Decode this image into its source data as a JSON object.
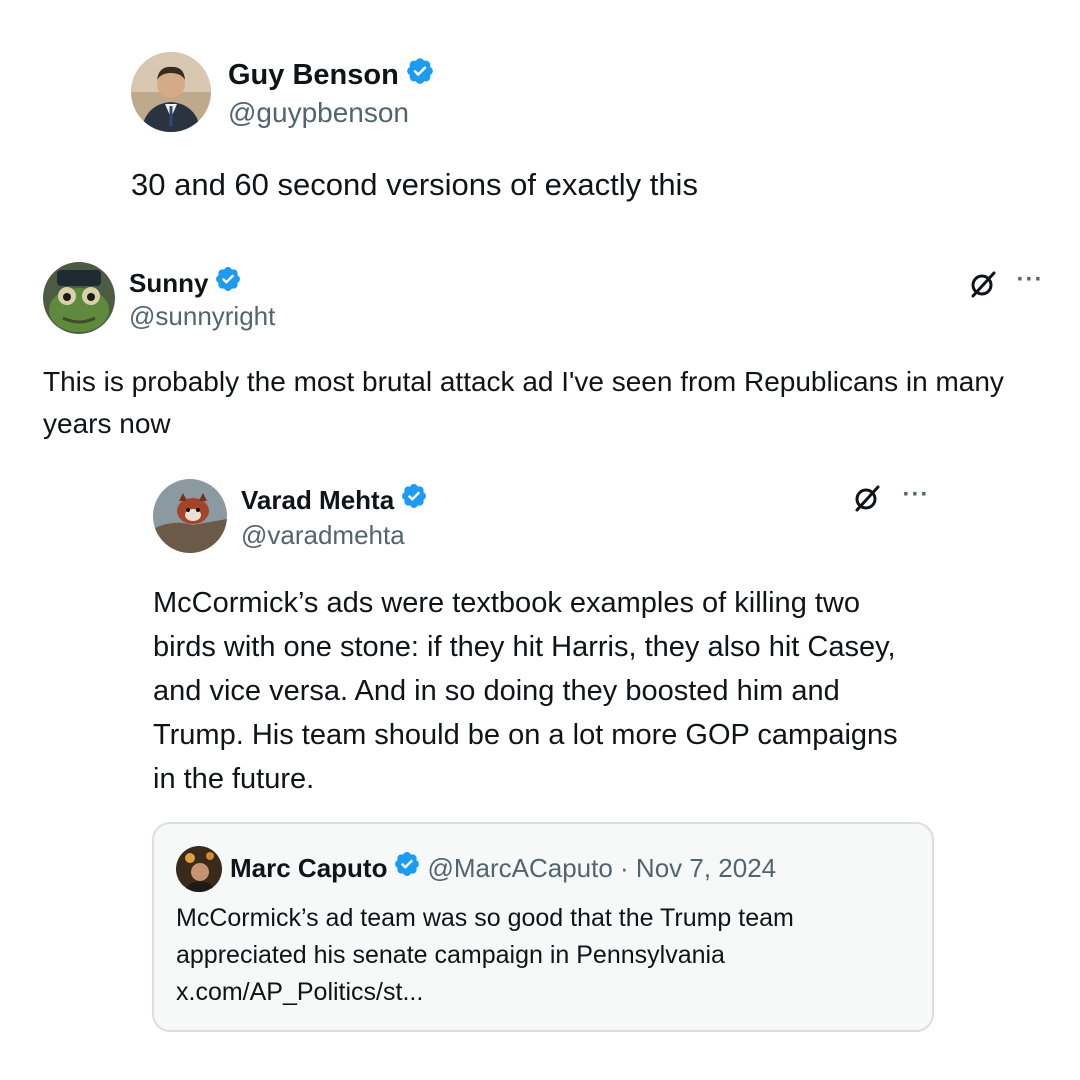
{
  "post1": {
    "author_name": "Guy Benson",
    "handle": "@guypbenson",
    "verified_icon": "verified-badge-icon",
    "text": "30 and 60 second versions of exactly this"
  },
  "post2": {
    "author_name": "Sunny",
    "handle": "@sunnyright",
    "verified_icon": "verified-badge-icon",
    "action_icons": [
      "grok-icon",
      "more-icon"
    ],
    "more_label": "···",
    "text": "This is probably the most brutal attack ad I've seen from Republicans in many years now"
  },
  "post3": {
    "author_name": "Varad Mehta",
    "handle": "@varadmehta",
    "verified_icon": "verified-badge-icon",
    "action_icons": [
      "grok-icon",
      "more-icon"
    ],
    "more_label": "···",
    "text": "McCormick’s ads were textbook examples of killing two birds with one stone: if they hit Harris, they also hit Casey, and vice versa. And in so doing they boosted him and Trump. His team should be on a lot more GOP campaigns in the future."
  },
  "quote": {
    "author_name": "Marc Caputo",
    "handle_date": "@MarcACaputo · Nov 7, 2024",
    "verified_icon": "verified-badge-icon",
    "text": "McCormick’s ad team was so good that the Trump team appreciated his senate campaign in Pennsylvania",
    "link": "x.com/AP_Politics/st..."
  },
  "colors": {
    "text": "#0f1419",
    "secondary": "#536471",
    "verified": "#1d9bf0",
    "border": "#d9dee3",
    "card_bg": "#f7f9f9"
  }
}
